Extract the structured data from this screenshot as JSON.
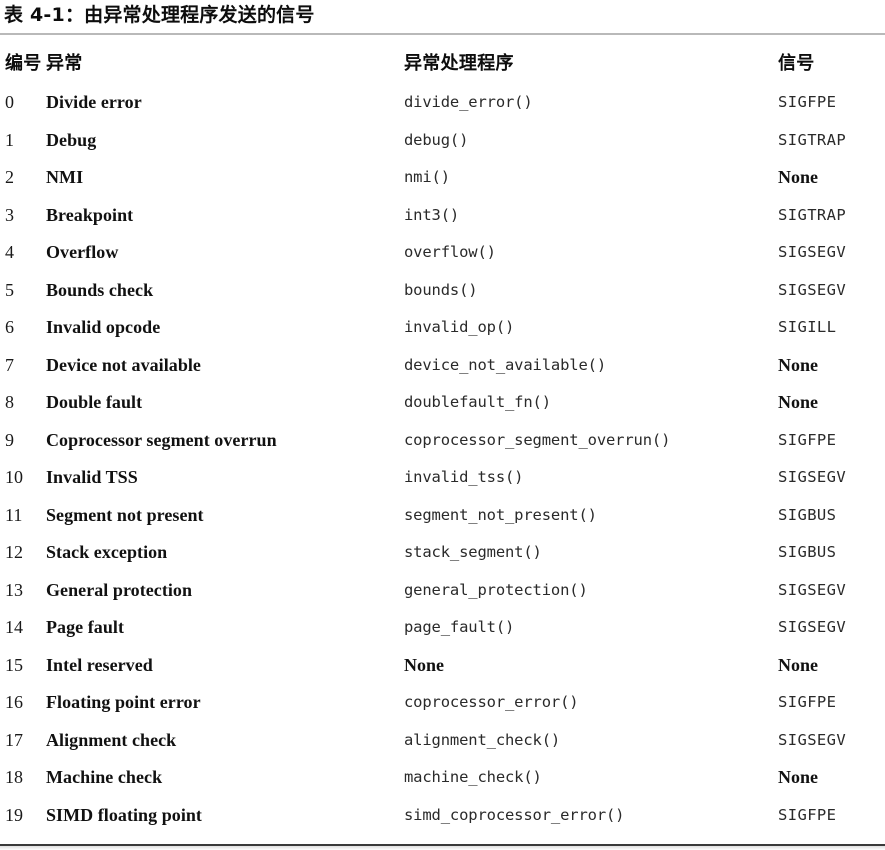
{
  "caption": "表 4-1：由异常处理程序发送的信号",
  "table": {
    "columns": [
      {
        "key": "num",
        "label": "编号"
      },
      {
        "key": "exc",
        "label": "异常"
      },
      {
        "key": "handler",
        "label": "异常处理程序"
      },
      {
        "key": "signal",
        "label": "信号"
      }
    ],
    "rows": [
      {
        "num": "0",
        "exc": "Divide error",
        "handler": "divide_error()",
        "handler_style": "mono",
        "signal": "SIGFPE",
        "signal_style": "mono"
      },
      {
        "num": "1",
        "exc": "Debug",
        "handler": "debug()",
        "handler_style": "mono",
        "signal": "SIGTRAP",
        "signal_style": "mono"
      },
      {
        "num": "2",
        "exc": "NMI",
        "handler": "nmi()",
        "handler_style": "mono",
        "signal": "None",
        "signal_style": "none"
      },
      {
        "num": "3",
        "exc": "Breakpoint",
        "handler": "int3()",
        "handler_style": "mono",
        "signal": "SIGTRAP",
        "signal_style": "mono"
      },
      {
        "num": "4",
        "exc": "Overflow",
        "handler": "overflow()",
        "handler_style": "mono",
        "signal": "SIGSEGV",
        "signal_style": "mono"
      },
      {
        "num": "5",
        "exc": "Bounds check",
        "handler": "bounds()",
        "handler_style": "mono",
        "signal": "SIGSEGV",
        "signal_style": "mono"
      },
      {
        "num": "6",
        "exc": "Invalid opcode",
        "handler": "invalid_op()",
        "handler_style": "mono",
        "signal": "SIGILL",
        "signal_style": "mono"
      },
      {
        "num": "7",
        "exc": "Device not available",
        "handler": "device_not_available()",
        "handler_style": "mono",
        "signal": "None",
        "signal_style": "none"
      },
      {
        "num": "8",
        "exc": "Double fault",
        "handler": "doublefault_fn()",
        "handler_style": "mono",
        "signal": "None",
        "signal_style": "none"
      },
      {
        "num": "9",
        "exc": "Coprocessor segment overrun",
        "handler": "coprocessor_segment_overrun()",
        "handler_style": "mono",
        "signal": "SIGFPE",
        "signal_style": "mono"
      },
      {
        "num": "10",
        "exc": "Invalid TSS",
        "handler": "invalid_tss()",
        "handler_style": "mono",
        "signal": "SIGSEGV",
        "signal_style": "mono"
      },
      {
        "num": "11",
        "exc": "Segment not present",
        "handler": "segment_not_present()",
        "handler_style": "mono",
        "signal": "SIGBUS",
        "signal_style": "mono"
      },
      {
        "num": "12",
        "exc": "Stack exception",
        "handler": "stack_segment()",
        "handler_style": "mono",
        "signal": "SIGBUS",
        "signal_style": "mono"
      },
      {
        "num": "13",
        "exc": "General protection",
        "handler": "general_protection()",
        "handler_style": "mono",
        "signal": "SIGSEGV",
        "signal_style": "mono"
      },
      {
        "num": "14",
        "exc": "Page fault",
        "handler": "page_fault()",
        "handler_style": "mono",
        "signal": "SIGSEGV",
        "signal_style": "mono"
      },
      {
        "num": "15",
        "exc": "Intel reserved",
        "handler": "None",
        "handler_style": "none",
        "signal": "None",
        "signal_style": "none"
      },
      {
        "num": "16",
        "exc": "Floating point error",
        "handler": "coprocessor_error()",
        "handler_style": "mono",
        "signal": "SIGFPE",
        "signal_style": "mono"
      },
      {
        "num": "17",
        "exc": "Alignment check",
        "handler": "alignment_check()",
        "handler_style": "mono",
        "signal": "SIGSEGV",
        "signal_style": "mono"
      },
      {
        "num": "18",
        "exc": "Machine check",
        "handler": "machine_check()",
        "handler_style": "mono",
        "signal": "None",
        "signal_style": "none"
      },
      {
        "num": "19",
        "exc": "SIMD floating point",
        "handler": "simd_coprocessor_error()",
        "handler_style": "mono",
        "signal": "SIGFPE",
        "signal_style": "mono"
      }
    ]
  }
}
